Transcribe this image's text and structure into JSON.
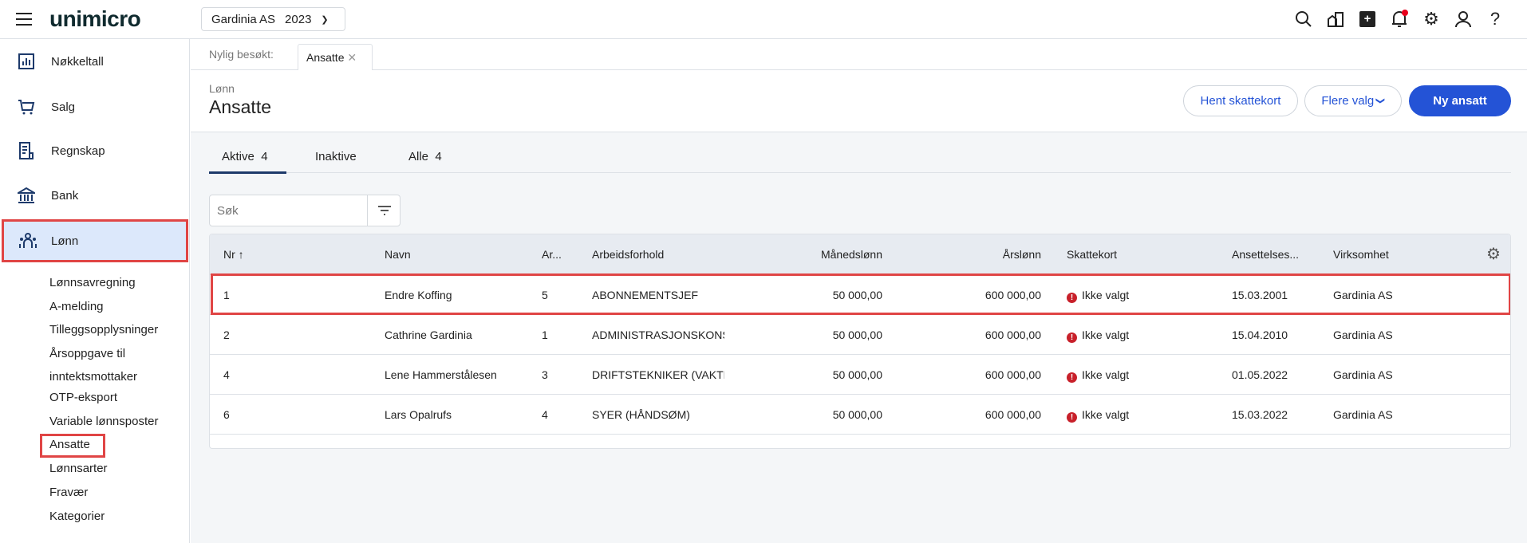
{
  "topbar": {
    "logo": "unimicro",
    "company": "Gardinia AS",
    "year": "2023",
    "icons": [
      "search-icon",
      "company-building-icon",
      "add-icon",
      "bell-icon",
      "settings-icon",
      "user-icon",
      "help-icon"
    ],
    "notification_color": "#e8001c"
  },
  "sidebar": {
    "items": [
      {
        "label": "Nøkkeltall",
        "icon": "chart-icon"
      },
      {
        "label": "Salg",
        "icon": "cart-icon"
      },
      {
        "label": "Regnskap",
        "icon": "ledger-icon"
      },
      {
        "label": "Bank",
        "icon": "bank-icon"
      },
      {
        "label": "Lønn",
        "icon": "people-icon",
        "active": true
      }
    ],
    "sub_items": [
      "Lønnsavregning",
      "A-melding",
      "Tilleggsopplysninger",
      "Årsoppgave til inntektsmottaker",
      "OTP-eksport",
      "Variable lønnsposter",
      "Ansatte",
      "Lønnsarter",
      "Fravær",
      "Kategorier"
    ],
    "active_sub": "Ansatte"
  },
  "recent": {
    "label": "Nylig besøkt:",
    "tab": "Ansatte"
  },
  "header": {
    "breadcrumb": "Lønn",
    "title": "Ansatte",
    "buttons": {
      "fetch": "Hent skattekort",
      "more": "Flere valg",
      "new": "Ny ansatt"
    }
  },
  "tabs": [
    {
      "label": "Aktive",
      "count": "4"
    },
    {
      "label": "Inaktive",
      "count": ""
    },
    {
      "label": "Alle",
      "count": "4"
    }
  ],
  "search": {
    "placeholder": "Søk"
  },
  "table": {
    "columns": [
      "Nr",
      "Navn",
      "Ar...",
      "Arbeidsforhold",
      "Månedslønn",
      "Årslønn",
      "Skattekort",
      "Ansettelses...",
      "Virksomhet"
    ],
    "rows": [
      [
        "1",
        "Endre Koffing",
        "5",
        "ABONNEMENTSJEF",
        "50 000,00",
        "600 000,00",
        "Ikke valgt",
        "15.03.2001",
        "Gardinia AS"
      ],
      [
        "2",
        "Cathrine Gardinia",
        "1",
        "ADMINISTRASJONSKONSULENT",
        "50 000,00",
        "600 000,00",
        "Ikke valgt",
        "15.04.2010",
        "Gardinia AS"
      ],
      [
        "4",
        "Lene Hammerstålesen",
        "3",
        "DRIFTSTEKNIKER (VAKTMESTER)",
        "50 000,00",
        "600 000,00",
        "Ikke valgt",
        "01.05.2022",
        "Gardinia AS"
      ],
      [
        "6",
        "Lars Opalrufs",
        "4",
        "SYER (HÅNDSØM)",
        "50 000,00",
        "600 000,00",
        "Ikke valgt",
        "15.03.2022",
        "Gardinia AS"
      ]
    ]
  },
  "colors": {
    "accent": "#2453d6",
    "highlight": "#e04545",
    "error": "#c8202a",
    "active_nav_bg": "#dce8fb"
  }
}
